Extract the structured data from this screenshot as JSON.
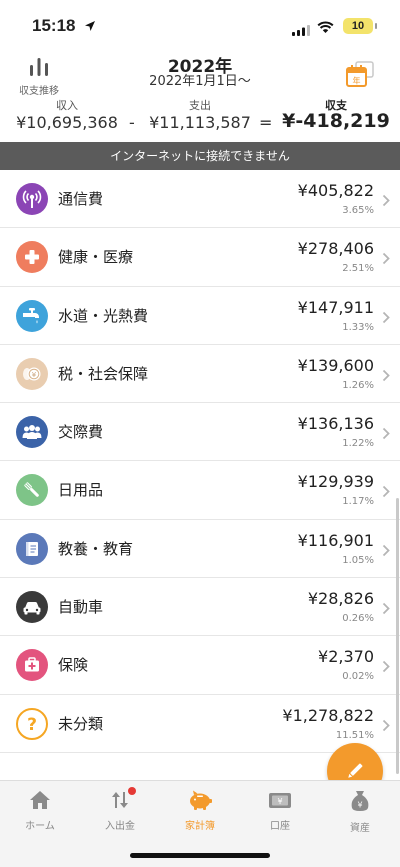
{
  "status": {
    "time": "15:18",
    "battery": "10"
  },
  "header": {
    "trend_label": "収支推移",
    "title": "2022年",
    "subtitle": "2022年1月1日〜",
    "income_label": "収入",
    "income_value": "¥10,695,368",
    "minus_op": "-",
    "expense_label": "支出",
    "expense_value": "¥11,113,587",
    "equals_op": "=",
    "balance_label": "収支",
    "balance_value": "¥-418,219",
    "calendar_badge": "年"
  },
  "banner": "インターネットに接続できません",
  "categories": [
    {
      "name": "通信費",
      "amount": "¥405,822",
      "percent": "3.65%",
      "icon": "antenna-icon",
      "color": "#8b45b5"
    },
    {
      "name": "健康・医療",
      "amount": "¥278,406",
      "percent": "2.51%",
      "icon": "plus-cross-icon",
      "color": "#ef7d5e"
    },
    {
      "name": "水道・光熱費",
      "amount": "¥147,911",
      "percent": "1.33%",
      "icon": "faucet-icon",
      "color": "#3ea3db"
    },
    {
      "name": "税・社会保障",
      "amount": "¥139,600",
      "percent": "1.26%",
      "icon": "coins-icon",
      "color": "#e9cdb0"
    },
    {
      "name": "交際費",
      "amount": "¥136,136",
      "percent": "1.22%",
      "icon": "people-icon",
      "color": "#3b63a8"
    },
    {
      "name": "日用品",
      "amount": "¥129,939",
      "percent": "1.17%",
      "icon": "toothbrush-icon",
      "color": "#7ec488"
    },
    {
      "name": "教養・教育",
      "amount": "¥116,901",
      "percent": "1.05%",
      "icon": "book-icon",
      "color": "#5b79b9"
    },
    {
      "name": "自動車",
      "amount": "¥28,826",
      "percent": "0.26%",
      "icon": "car-icon",
      "color": "#3a3a3a"
    },
    {
      "name": "保険",
      "amount": "¥2,370",
      "percent": "0.02%",
      "icon": "first-aid-icon",
      "color": "#e3547e"
    },
    {
      "name": "未分類",
      "amount": "¥1,278,822",
      "percent": "11.51%",
      "icon": "question-icon",
      "color": "#f5a623"
    }
  ],
  "tabs": [
    {
      "label": "ホーム",
      "icon": "home-icon"
    },
    {
      "label": "入出金",
      "icon": "transfer-icon"
    },
    {
      "label": "家計簿",
      "icon": "piggy-bank-icon"
    },
    {
      "label": "口座",
      "icon": "wallet-icon"
    },
    {
      "label": "資産",
      "icon": "money-bag-icon"
    }
  ],
  "accent_color": "#f39a2c"
}
